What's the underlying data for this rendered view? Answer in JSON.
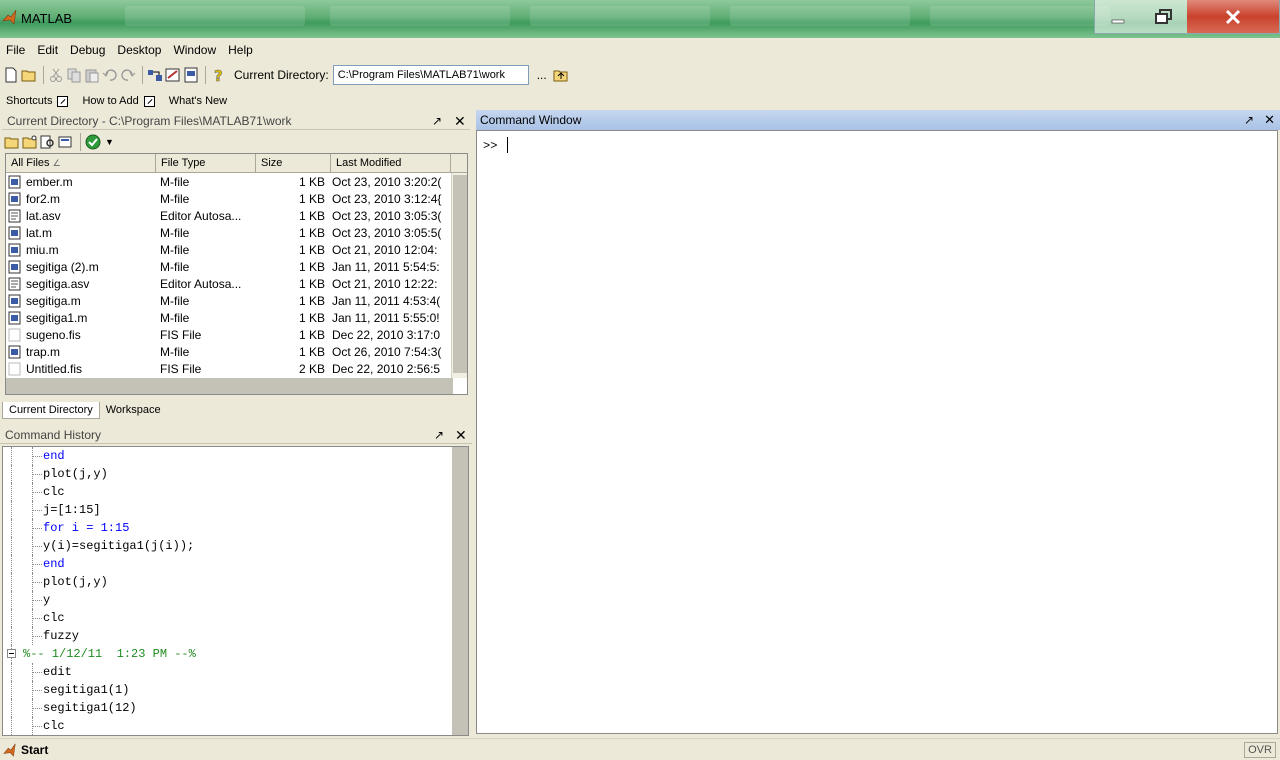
{
  "window": {
    "title": "MATLAB"
  },
  "menu": [
    "File",
    "Edit",
    "Debug",
    "Desktop",
    "Window",
    "Help"
  ],
  "toolbar": {
    "current_directory_label": "Current Directory:",
    "current_directory_value": "C:\\Program Files\\MATLAB71\\work",
    "browse_label": "..."
  },
  "shortcuts": {
    "label": "Shortcuts",
    "items": [
      "How to Add",
      "What's New"
    ]
  },
  "current_directory_panel": {
    "title": "Current Directory - C:\\Program Files\\MATLAB71\\work",
    "columns": [
      "All Files",
      "File Type",
      "Size",
      "Last Modified"
    ],
    "files": [
      {
        "name": "ember.m",
        "type": "M-file",
        "size": "1 KB",
        "modified": "Oct 23, 2010 3:20:2(",
        "icon": "m-file-icon"
      },
      {
        "name": "for2.m",
        "type": "M-file",
        "size": "1 KB",
        "modified": "Oct 23, 2010 3:12:4{",
        "icon": "m-file-icon"
      },
      {
        "name": "lat.asv",
        "type": "Editor Autosa...",
        "size": "1 KB",
        "modified": "Oct 23, 2010 3:05:3(",
        "icon": "asv-file-icon"
      },
      {
        "name": "lat.m",
        "type": "M-file",
        "size": "1 KB",
        "modified": "Oct 23, 2010 3:05:5(",
        "icon": "m-file-icon"
      },
      {
        "name": "miu.m",
        "type": "M-file",
        "size": "1 KB",
        "modified": "Oct 21, 2010 12:04:",
        "icon": "m-file-icon"
      },
      {
        "name": "segitiga (2).m",
        "type": "M-file",
        "size": "1 KB",
        "modified": "Jan 11, 2011 5:54:5:",
        "icon": "m-file-icon"
      },
      {
        "name": "segitiga.asv",
        "type": "Editor Autosa...",
        "size": "1 KB",
        "modified": "Oct 21, 2010 12:22:",
        "icon": "asv-file-icon"
      },
      {
        "name": "segitiga.m",
        "type": "M-file",
        "size": "1 KB",
        "modified": "Jan 11, 2011 4:53:4(",
        "icon": "m-file-icon"
      },
      {
        "name": "segitiga1.m",
        "type": "M-file",
        "size": "1 KB",
        "modified": "Jan 11, 2011 5:55:0!",
        "icon": "m-file-icon"
      },
      {
        "name": "sugeno.fis",
        "type": "FIS File",
        "size": "1 KB",
        "modified": "Dec 22, 2010 3:17:0",
        "icon": "blank-file-icon"
      },
      {
        "name": "trap.m",
        "type": "M-file",
        "size": "1 KB",
        "modified": "Oct 26, 2010 7:54:3(",
        "icon": "m-file-icon"
      },
      {
        "name": "Untitled.fis",
        "type": "FIS File",
        "size": "2 KB",
        "modified": "Dec 22, 2010 2:56:5",
        "icon": "blank-file-icon"
      }
    ],
    "tabs": [
      "Current Directory",
      "Workspace"
    ]
  },
  "command_history": {
    "title": "Command History",
    "lines": [
      {
        "text": "end",
        "kind": "kw"
      },
      {
        "text": "plot(j,y)",
        "kind": "cmd"
      },
      {
        "text": "clc",
        "kind": "cmd"
      },
      {
        "text": "j=[1:15]",
        "kind": "cmd"
      },
      {
        "text": "for i = 1:15",
        "kind": "kw"
      },
      {
        "text": "y(i)=segitiga1(j(i));",
        "kind": "cmd"
      },
      {
        "text": "end",
        "kind": "kw"
      },
      {
        "text": "plot(j,y)",
        "kind": "cmd"
      },
      {
        "text": "y",
        "kind": "cmd"
      },
      {
        "text": "clc",
        "kind": "cmd"
      },
      {
        "text": "fuzzy",
        "kind": "cmd"
      },
      {
        "text": "%-- 1/12/11  1:23 PM --%",
        "kind": "sess"
      },
      {
        "text": "edit",
        "kind": "cmd"
      },
      {
        "text": "segitiga1(1)",
        "kind": "cmd"
      },
      {
        "text": "segitiga1(12)",
        "kind": "cmd"
      },
      {
        "text": "clc",
        "kind": "cmd"
      }
    ]
  },
  "command_window": {
    "title": "Command Window",
    "prompt": ">>"
  },
  "statusbar": {
    "start_label": "Start",
    "ovr_label": "OVR"
  }
}
